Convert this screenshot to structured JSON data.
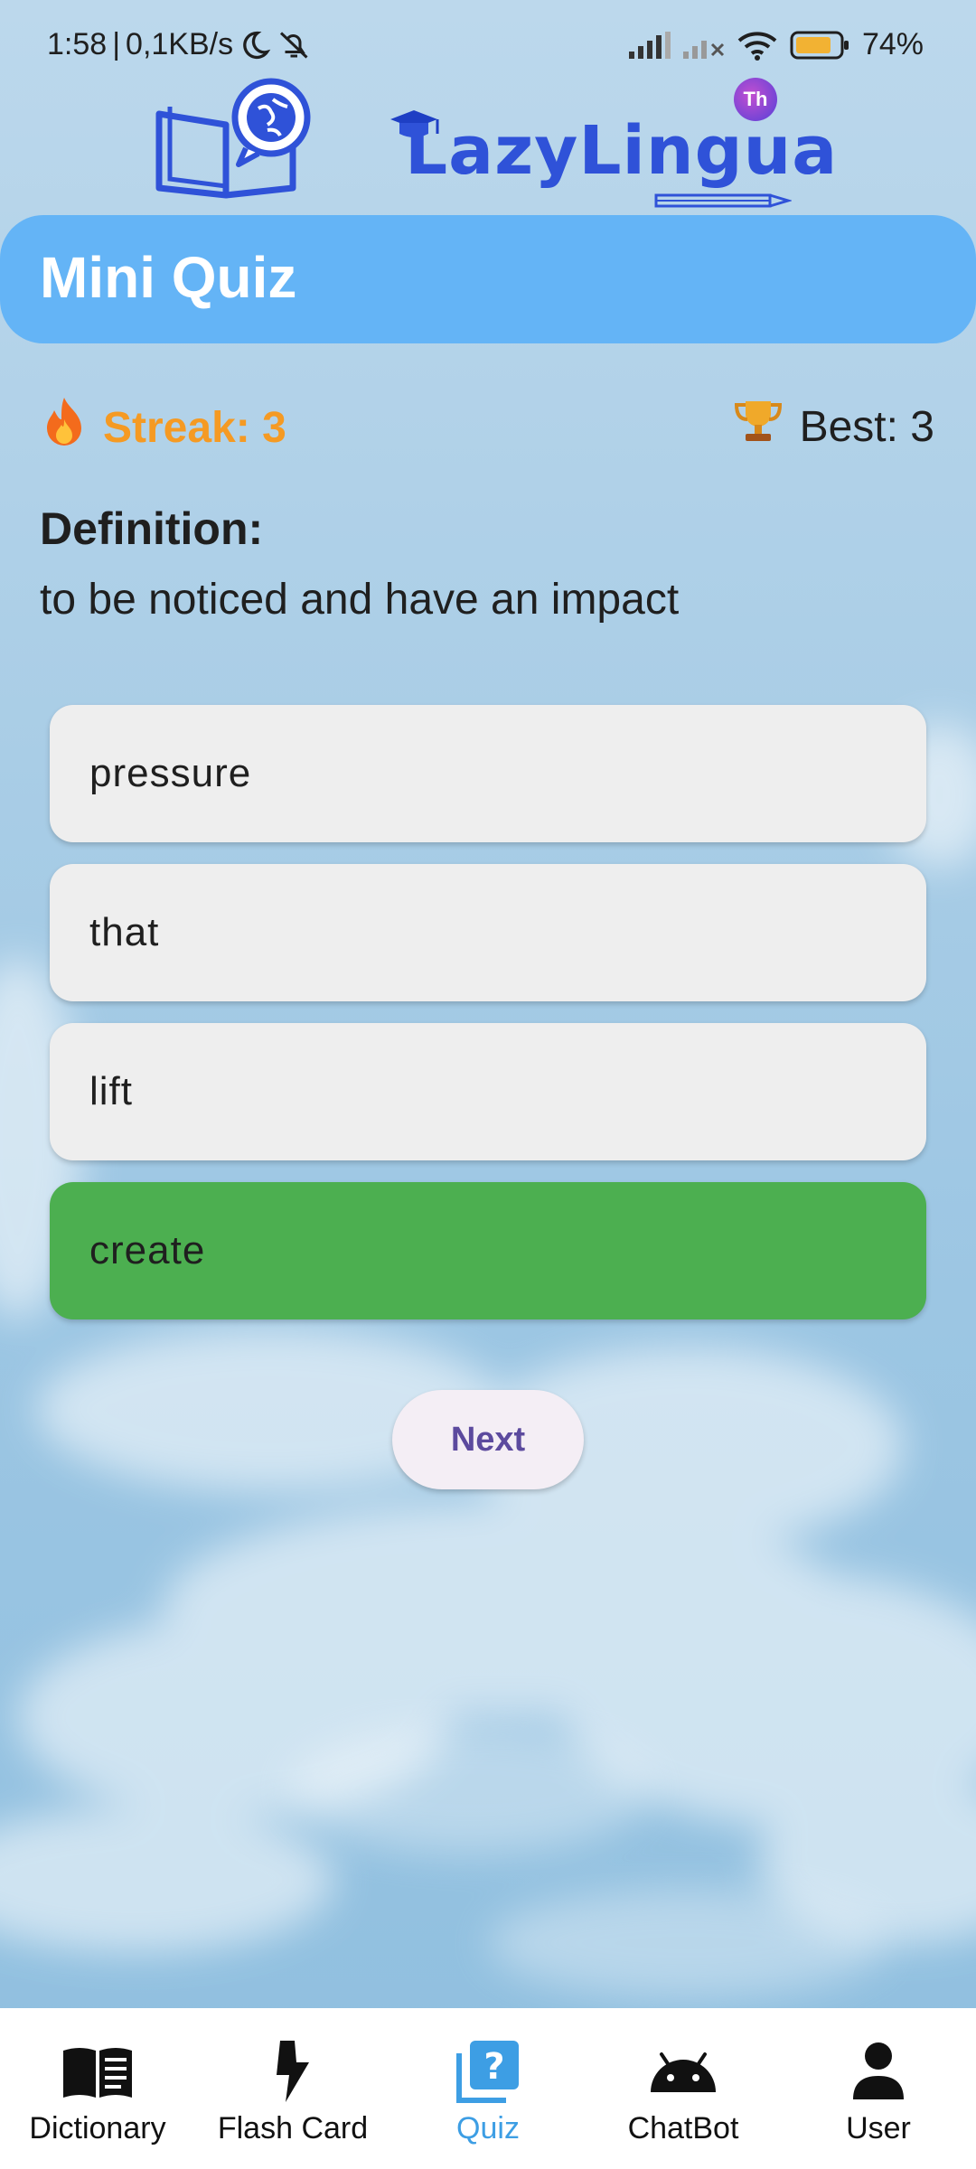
{
  "status_bar": {
    "time": "1:58",
    "speed": "0,1KB/s",
    "battery": "74%",
    "icons": [
      "moon-icon",
      "mute-icon",
      "signal-icon",
      "signal-icon-no-service",
      "wifi-icon",
      "battery-icon"
    ]
  },
  "header": {
    "brand": "LazyLingua",
    "logo_icon": "book-globe-icon",
    "badge": "Th"
  },
  "title_bar": {
    "title": "Mini Quiz"
  },
  "stats": {
    "streak_label": "Streak: 3",
    "best_label": "Best: 3",
    "streak_icon": "fire-icon",
    "best_icon": "trophy-icon"
  },
  "question": {
    "heading": "Definition:",
    "text": "to be noticed and have an impact"
  },
  "options": [
    {
      "label": "pressure",
      "state": "default"
    },
    {
      "label": "that",
      "state": "default"
    },
    {
      "label": "lift",
      "state": "default"
    },
    {
      "label": "create",
      "state": "correct"
    }
  ],
  "next_button": {
    "label": "Next"
  },
  "bottom_nav": {
    "active": "Quiz",
    "items": [
      {
        "label": "Dictionary",
        "icon": "book-icon"
      },
      {
        "label": "Flash Card",
        "icon": "lightning-icon"
      },
      {
        "label": "Quiz",
        "icon": "quiz-icon"
      },
      {
        "label": "ChatBot",
        "icon": "android-icon"
      },
      {
        "label": "User",
        "icon": "user-icon"
      }
    ]
  },
  "colors": {
    "title_bar": "#64b4f6",
    "streak": "#f59a23",
    "correct": "#4caf50",
    "option": "#eeeeee",
    "brand": "#2f52d8",
    "nav_active": "#3d9ee4"
  }
}
